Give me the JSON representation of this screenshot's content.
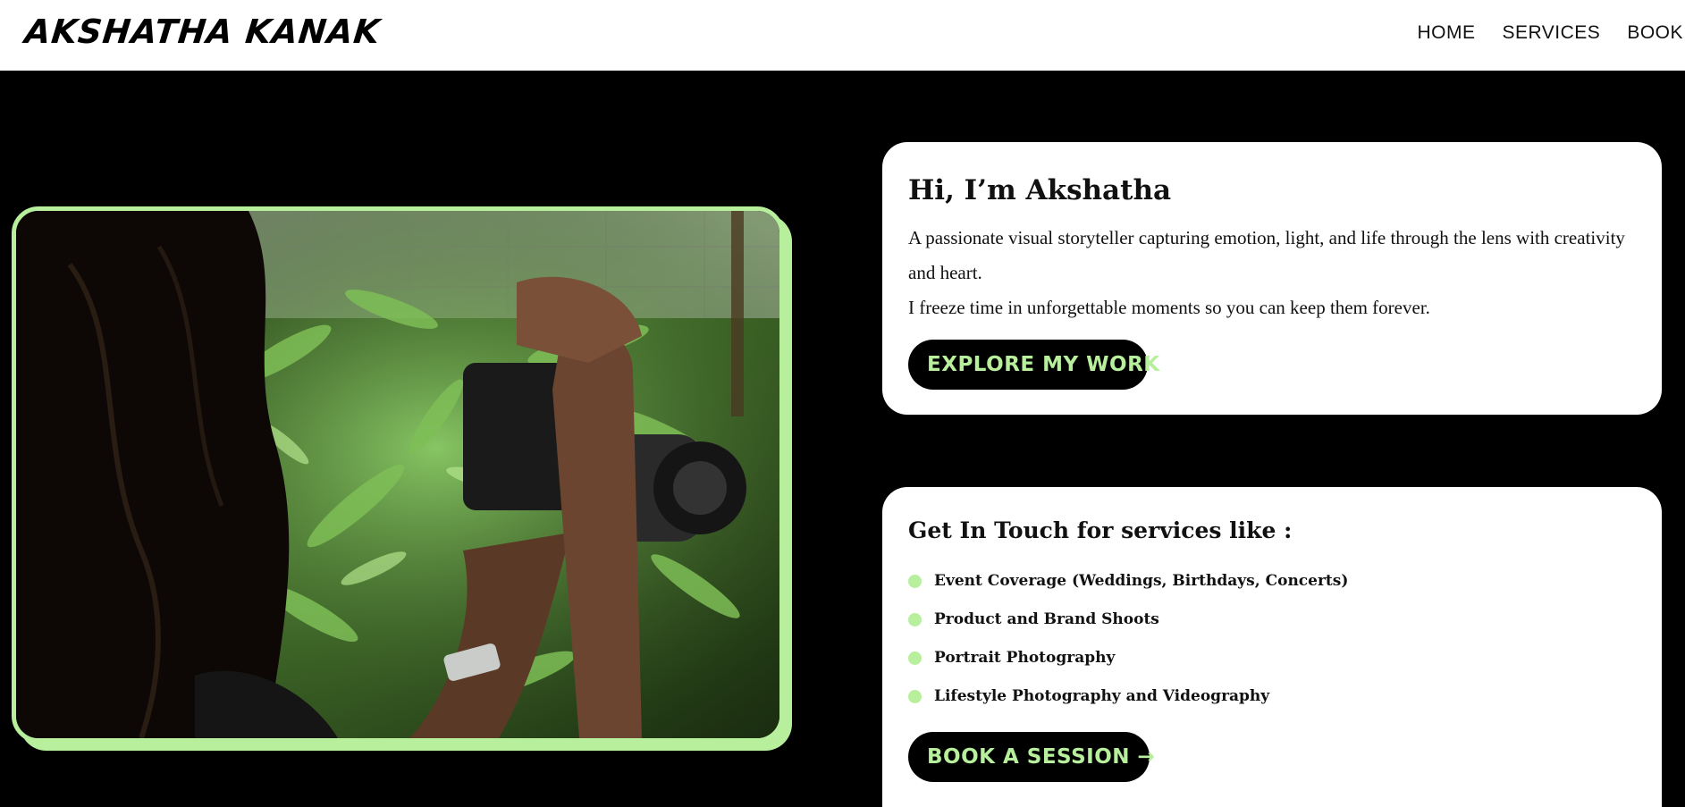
{
  "header": {
    "logo": "AKSHATHA KANAK",
    "nav": [
      {
        "label": "HOME"
      },
      {
        "label": "SERVICES"
      },
      {
        "label": "BOOK"
      }
    ]
  },
  "hero": {
    "title": "Hi, I’m Akshatha",
    "intro_line1": "A passionate visual storyteller capturing emotion, light, and life through the lens with creativity and heart.",
    "intro_line2": "I freeze time in unforgettable moments so you can keep them forever.",
    "cta_label": "EXPLORE MY WORK"
  },
  "services": {
    "title": "Get In Touch for services like :",
    "items": [
      "Event Coverage (Weddings, Birthdays, Concerts)",
      "Product and Brand Shoots",
      "Portrait Photography",
      "Lifestyle Photography and Videography"
    ],
    "cta_label": "BOOK A SESSION →"
  },
  "photo": {
    "subject": "photographer-with-camera-in-ferns"
  },
  "colors": {
    "accent": "#b7ef9c",
    "background": "#000000",
    "card": "#ffffff",
    "header": "#ffffff"
  }
}
